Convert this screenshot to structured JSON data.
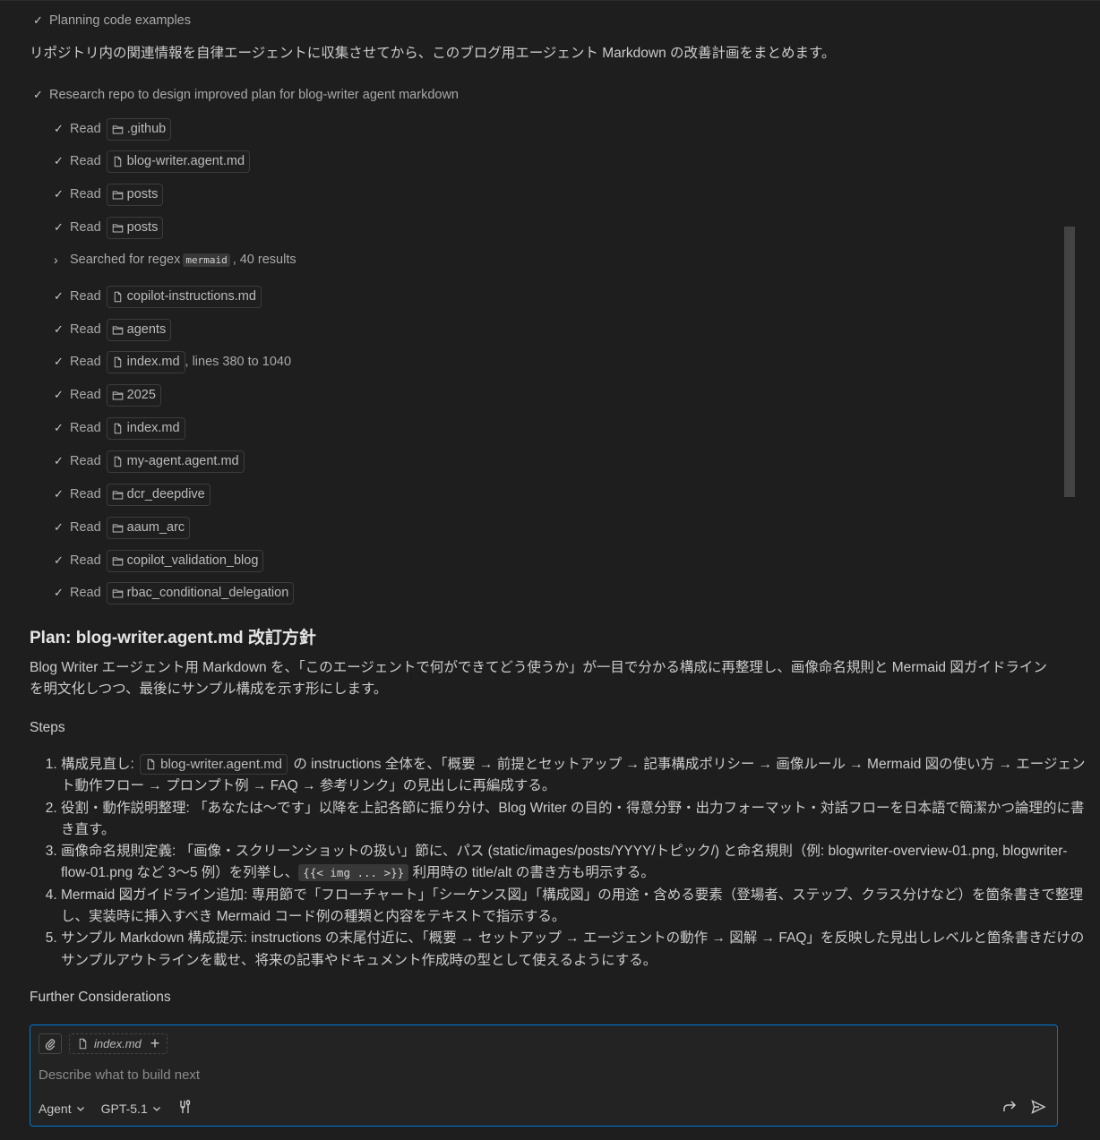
{
  "top_step": "Planning code examples",
  "intro": "リポジトリ内の関連情報を自律エージェントに収集させてから、このブログ用エージェント Markdown の改善計画をまとめます。",
  "research": {
    "title": "Research repo to design improved plan for blog-writer agent markdown",
    "read_label": "Read",
    "items": [
      {
        "type": "folder",
        "name": ".github"
      },
      {
        "type": "file",
        "name": "blog-writer.agent.md"
      },
      {
        "type": "folder",
        "name": "posts"
      },
      {
        "type": "folder",
        "name": "posts"
      },
      {
        "type": "file",
        "name": "copilot-instructions.md"
      },
      {
        "type": "folder",
        "name": "agents"
      },
      {
        "type": "file",
        "name": "index.md",
        "suffix": ", lines 380 to 1040"
      },
      {
        "type": "folder",
        "name": "2025"
      },
      {
        "type": "file",
        "name": "index.md"
      },
      {
        "type": "file",
        "name": "my-agent.agent.md"
      },
      {
        "type": "folder",
        "name": "dcr_deepdive"
      },
      {
        "type": "folder",
        "name": "aaum_arc"
      },
      {
        "type": "folder",
        "name": "copilot_validation_blog"
      },
      {
        "type": "folder",
        "name": "rbac_conditional_delegation"
      }
    ],
    "search": {
      "prefix": "Searched for regex",
      "pattern": "mermaid",
      "suffix": ", 40 results"
    }
  },
  "plan": {
    "title": "Plan: blog-writer.agent.md 改訂方針",
    "summary": "Blog Writer エージェント用 Markdown を、「このエージェントで何ができてどう使うか」が一目で分かる構成に再整理し、画像命名規則と Mermaid 図ガイドラインを明文化しつつ、最後にサンプル構成を示す形にします。",
    "steps_heading": "Steps",
    "steps": {
      "s1_a": "構成見直し: ",
      "s1_chip": "blog-writer.agent.md",
      "s1_b": " の instructions 全体を、「概要 → 前提とセットアップ → 記事構成ポリシー → 画像ルール → Mermaid 図の使い方 → エージェント動作フロー → プロンプト例 → FAQ → 参考リンク」の見出しに再編成する。",
      "s2": "役割・動作説明整理: 「あなたは〜です」以降を上記各節に振り分け、Blog Writer の目的・得意分野・出力フォーマット・対話フローを日本語で簡潔かつ論理的に書き直す。",
      "s3_a": "画像命名規則定義: 「画像・スクリーンショットの扱い」節に、パス (static/images/posts/YYYY/トピック/) と命名規則（例: blogwriter-overview-01.png, blogwriter-flow-01.png など 3〜5 例）を列挙し、",
      "s3_code": "{{< img ... >}}",
      "s3_b": " 利用時の title/alt の書き方も明示する。",
      "s4": "Mermaid 図ガイドライン追加: 専用節で「フローチャート」「シーケンス図」「構成図」の用途・含める要素（登場者、ステップ、クラス分けなど）を箇条書きで整理し、実装時に挿入すべき Mermaid コード例の種類と内容をテキストで指示する。",
      "s5": "サンプル Markdown 構成提示: instructions の末尾付近に、「概要 → セットアップ → エージェントの動作 → 図解 → FAQ」を反映した見出しレベルと箇条書きだけのサンプルアウトラインを載せ、将来の記事やドキュメント作成時の型として使えるようにする。"
    },
    "further": "Further Considerations"
  },
  "composer": {
    "context_file": "index.md",
    "placeholder": "Describe what to build next",
    "mode": "Agent",
    "model": "GPT-5.1"
  },
  "colors": {
    "accent": "#0078d4",
    "background": "#1e1e1e",
    "text": "#cccccc"
  }
}
